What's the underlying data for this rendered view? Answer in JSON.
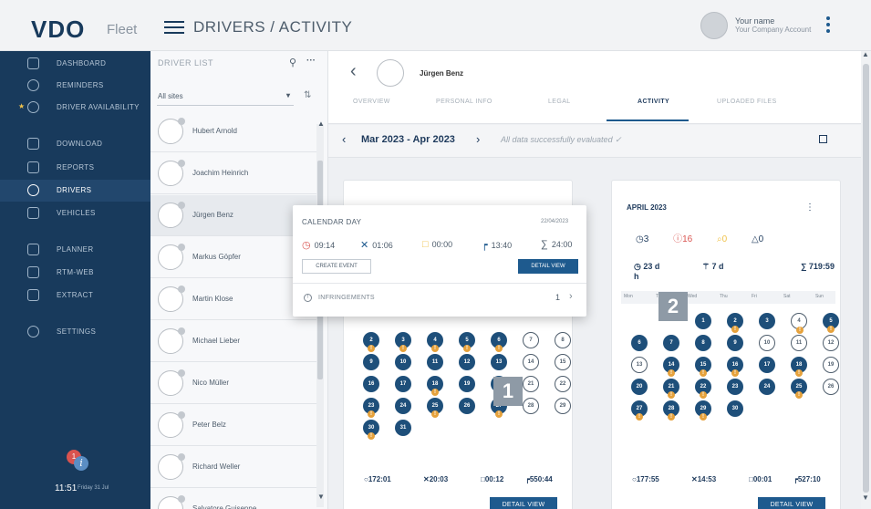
{
  "header": {
    "brand": "VDO",
    "brand_sub": "Fleet",
    "title": "DRIVERS / ACTIVITY",
    "user_name": "Your name",
    "user_account": "Your Company Account"
  },
  "sidebar": {
    "items": [
      {
        "label": "DASHBOARD",
        "icon": "dashboard-icon"
      },
      {
        "label": "REMINDERS",
        "icon": "bell-icon"
      },
      {
        "label": "DRIVER AVAILABILITY",
        "icon": "availability-icon",
        "starred": true
      },
      {
        "label": "DOWNLOAD",
        "icon": "download-icon"
      },
      {
        "label": "REPORTS",
        "icon": "reports-icon"
      },
      {
        "label": "DRIVERS",
        "icon": "drivers-icon",
        "active": true
      },
      {
        "label": "VEHICLES",
        "icon": "truck-icon"
      },
      {
        "label": "PLANNER",
        "icon": "planner-icon"
      },
      {
        "label": "RTM-WEB",
        "icon": "rtm-icon"
      },
      {
        "label": "EXTRACT",
        "icon": "extract-icon"
      },
      {
        "label": "SETTINGS",
        "icon": "settings-icon"
      }
    ],
    "notification_count": "1",
    "clock": "11:51",
    "clock_date": "Friday 31 Jul"
  },
  "driver_list": {
    "header": "DRIVER LIST",
    "filter": "All sites",
    "drivers": [
      "Hubert Arnold",
      "Joachim Heinrich",
      "Jürgen Benz",
      "Markus Göpfer",
      "Martin Klose",
      "Michael Lieber",
      "Nico Müller",
      "Peter Belz",
      "Richard Weller",
      "Salvatore Guisenne"
    ],
    "selected_index": 2
  },
  "profile": {
    "name": "Jürgen Benz",
    "tabs": [
      "OVERVIEW",
      "PERSONAL INFO",
      "LEGAL",
      "ACTIVITY",
      "UPLOADED FILES"
    ],
    "active_tab": "ACTIVITY"
  },
  "period": {
    "label": "Mar 2023 - Apr 2023",
    "status": "All data successfully evaluated"
  },
  "popup": {
    "title": "CALENDAR DAY",
    "date": "22/04/2023",
    "stats": [
      {
        "icon": "drive-icon",
        "value": "09:14",
        "color": "#d9534f"
      },
      {
        "icon": "work-icon",
        "value": "01:06",
        "color": "#1e5a8e"
      },
      {
        "icon": "availability-icon",
        "value": "00:00",
        "color": "#f0c24b"
      },
      {
        "icon": "rest-icon",
        "value": "13:40",
        "color": "#1e5a8e"
      },
      {
        "icon": "sum-icon",
        "value": "24:00",
        "color": "#4e5d6c"
      }
    ],
    "create_label": "CREATE EVENT",
    "detail_label": "DETAIL VIEW",
    "infringements_label": "INFRINGEMENTS",
    "infringements_count": "1"
  },
  "march": {
    "days": [
      {
        "d": "2",
        "f": true,
        "a": true
      },
      {
        "d": "3",
        "f": true,
        "a": true
      },
      {
        "d": "4",
        "f": true,
        "a": true
      },
      {
        "d": "5",
        "f": true,
        "a": true
      },
      {
        "d": "6",
        "f": true,
        "a": true
      },
      {
        "d": "7",
        "f": false
      },
      {
        "d": "8",
        "f": false
      },
      {
        "d": "9",
        "f": true
      },
      {
        "d": "10",
        "f": true
      },
      {
        "d": "11",
        "f": true
      },
      {
        "d": "12",
        "f": true
      },
      {
        "d": "13",
        "f": true
      },
      {
        "d": "14",
        "f": false
      },
      {
        "d": "15",
        "f": false
      },
      {
        "d": "16",
        "f": true
      },
      {
        "d": "17",
        "f": true
      },
      {
        "d": "18",
        "f": true,
        "a": true
      },
      {
        "d": "19",
        "f": true
      },
      {
        "d": "20",
        "f": true
      },
      {
        "d": "21",
        "f": false
      },
      {
        "d": "22",
        "f": false
      },
      {
        "d": "23",
        "f": true,
        "a": true
      },
      {
        "d": "24",
        "f": true
      },
      {
        "d": "25",
        "f": true,
        "a": true
      },
      {
        "d": "26",
        "f": true
      },
      {
        "d": "27",
        "f": true,
        "a": true
      },
      {
        "d": "28",
        "f": false
      },
      {
        "d": "29",
        "f": false
      },
      {
        "d": "30",
        "f": true,
        "a": true
      },
      {
        "d": "31",
        "f": true
      }
    ],
    "footer": {
      "drive": "172:01",
      "work": "20:03",
      "avail": "00:12",
      "rest": "550:44"
    },
    "detail_label": "DETAIL VIEW"
  },
  "april": {
    "title": "APRIL 2023",
    "stats": [
      {
        "icon": "drive-icon",
        "value": "3",
        "color": "#1e3a5c"
      },
      {
        "icon": "infringement-icon",
        "value": "16",
        "color": "#d9534f"
      },
      {
        "icon": "search-icon",
        "value": "0",
        "color": "#f0c24b"
      },
      {
        "icon": "warning-icon",
        "value": "0",
        "color": "#1e3a5c"
      }
    ],
    "summary": [
      "23 d",
      "7 d",
      "719:59 h"
    ],
    "weekdays": [
      "Mon",
      "Tue",
      "Wed",
      "Thu",
      "Fri",
      "Sat",
      "Sun"
    ],
    "days": [
      {
        "d": "1",
        "f": true
      },
      {
        "d": "2",
        "f": true,
        "a": true
      },
      {
        "d": "3",
        "f": true
      },
      {
        "d": "4",
        "f": false,
        "a": true
      },
      {
        "d": "5",
        "f": true,
        "a": true
      },
      {
        "d": "6",
        "f": true
      },
      {
        "d": "7",
        "f": true
      },
      {
        "d": "8",
        "f": true
      },
      {
        "d": "9",
        "f": true
      },
      {
        "d": "10",
        "f": false
      },
      {
        "d": "11",
        "f": false
      },
      {
        "d": "12",
        "f": false
      },
      {
        "d": "13",
        "f": false
      },
      {
        "d": "14",
        "f": true,
        "a": true
      },
      {
        "d": "15",
        "f": true,
        "a": true
      },
      {
        "d": "16",
        "f": true,
        "a": true
      },
      {
        "d": "17",
        "f": true
      },
      {
        "d": "18",
        "f": true,
        "a": true
      },
      {
        "d": "19",
        "f": false
      },
      {
        "d": "20",
        "f": true
      },
      {
        "d": "21",
        "f": true,
        "a": true
      },
      {
        "d": "22",
        "f": true,
        "a": true
      },
      {
        "d": "23",
        "f": true
      },
      {
        "d": "24",
        "f": true
      },
      {
        "d": "25",
        "f": true,
        "a": true
      },
      {
        "d": "26",
        "f": false
      },
      {
        "d": "27",
        "f": true,
        "a": true
      },
      {
        "d": "28",
        "f": true,
        "a": true
      },
      {
        "d": "29",
        "f": true,
        "a": true
      },
      {
        "d": "30",
        "f": true
      }
    ],
    "footer": {
      "drive": "177:55",
      "work": "14:53",
      "avail": "00:01",
      "rest": "527:10"
    },
    "detail_label": "DETAIL VIEW"
  },
  "tags": [
    "1",
    "2"
  ]
}
